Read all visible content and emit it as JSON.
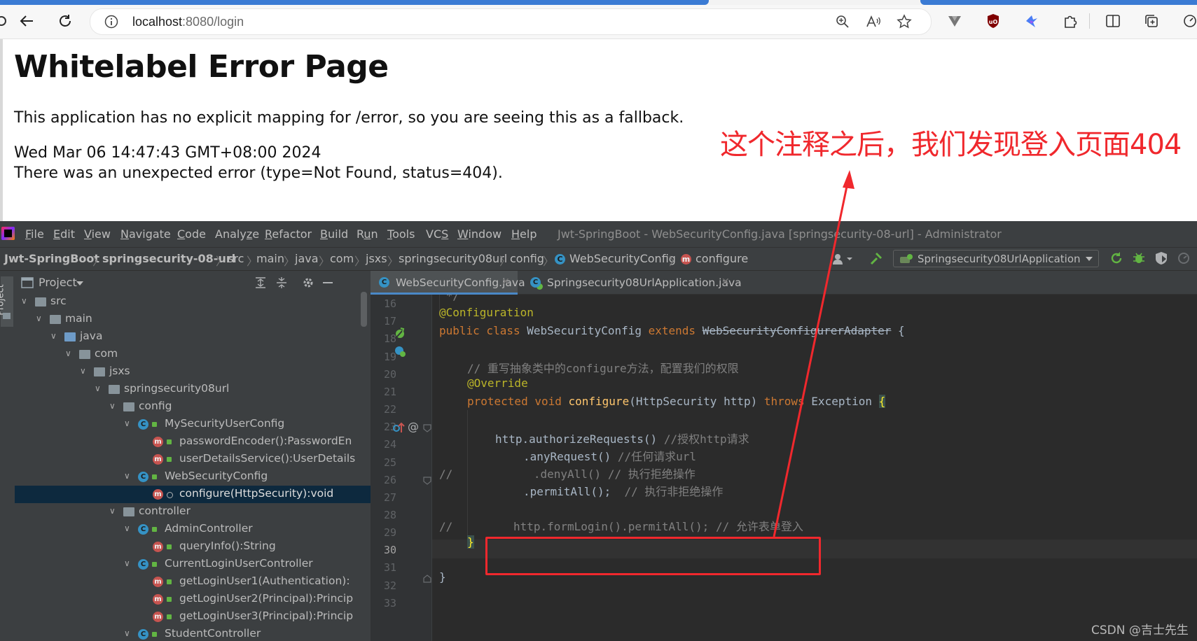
{
  "browser": {
    "url_host": "localhost",
    "url_rest": ":8080/login"
  },
  "page": {
    "title": "Whitelabel Error Page",
    "line1": "This application has no explicit mapping for /error, so you are seeing this as a fallback.",
    "line2": "Wed Mar 06 14:47:43 GMT+08:00 2024",
    "line3": "There was an unexpected error (type=Not Found, status=404)."
  },
  "annotation": {
    "text": "这个注释之后，我们发现登入页面404",
    "color": "#f0282d"
  },
  "ide": {
    "menu": [
      {
        "pre": "",
        "u": "F",
        "post": "ile"
      },
      {
        "pre": "",
        "u": "E",
        "post": "dit"
      },
      {
        "pre": "",
        "u": "V",
        "post": "iew"
      },
      {
        "pre": "",
        "u": "N",
        "post": "avigate"
      },
      {
        "pre": "",
        "u": "C",
        "post": "ode"
      },
      {
        "pre": "Analy",
        "u": "z",
        "post": "e"
      },
      {
        "pre": "",
        "u": "R",
        "post": "efactor"
      },
      {
        "pre": "",
        "u": "B",
        "post": "uild"
      },
      {
        "pre": "R",
        "u": "u",
        "post": "n"
      },
      {
        "pre": "",
        "u": "T",
        "post": "ools"
      },
      {
        "pre": "VC",
        "u": "S",
        "post": ""
      },
      {
        "pre": "",
        "u": "W",
        "post": "indow"
      },
      {
        "pre": "",
        "u": "H",
        "post": "elp"
      }
    ],
    "window_title": "Jwt-SpringBoot - WebSecurityConfig.java [springsecurity-08-url] - Administrator",
    "breadcrumbs": [
      "Jwt-SpringBoot",
      "springsecurity-08-url",
      "src",
      "main",
      "java",
      "com",
      "jsxs",
      "springsecurity08url",
      "config",
      "WebSecurityConfig",
      "configure"
    ],
    "run_config": "Springsecurity08UrlApplication",
    "project_panel": {
      "title": "Project",
      "side_label": "Project",
      "tree": [
        {
          "label": "src",
          "type": "folder"
        },
        {
          "label": "main",
          "type": "folder"
        },
        {
          "label": "java",
          "type": "folder-blue"
        },
        {
          "label": "com",
          "type": "package"
        },
        {
          "label": "jsxs",
          "type": "package"
        },
        {
          "label": "springsecurity08url",
          "type": "package"
        },
        {
          "label": "config",
          "type": "package"
        },
        {
          "label": "MySecurityUserConfig",
          "type": "class"
        },
        {
          "label": "passwordEncoder():PasswordEn",
          "type": "method"
        },
        {
          "label": "userDetailsService():UserDetails",
          "type": "method"
        },
        {
          "label": "WebSecurityConfig",
          "type": "class"
        },
        {
          "label": "configure(HttpSecurity):void",
          "type": "method",
          "selected": true
        },
        {
          "label": "controller",
          "type": "package"
        },
        {
          "label": "AdminController",
          "type": "class"
        },
        {
          "label": "queryInfo():String",
          "type": "method"
        },
        {
          "label": "CurrentLoginUserController",
          "type": "class"
        },
        {
          "label": "getLoginUser1(Authentication):",
          "type": "method"
        },
        {
          "label": "getLoginUser2(Principal):Princip",
          "type": "method"
        },
        {
          "label": "getLoginUser3(Principal):Princip",
          "type": "method"
        },
        {
          "label": "StudentController",
          "type": "class"
        }
      ]
    },
    "editor_tabs": [
      {
        "label": "WebSecurityConfig.java",
        "active": true
      },
      {
        "label": "Springsecurity08UrlApplication.java",
        "active": false
      }
    ],
    "line_numbers": [
      "16",
      "17",
      "18",
      "19",
      "20",
      "21",
      "22",
      "23",
      "24",
      "25",
      "26",
      "27",
      "28",
      "29",
      "30",
      "31",
      "32",
      "33"
    ],
    "current_line": "30",
    "code": {
      "l17": "@Configuration",
      "l18_kw": "public class ",
      "l18_name": "WebSecurityConfig ",
      "l18_ext": "extends ",
      "l18_super": "WebSecurityConfigurerAdapter",
      "l18_end": " {",
      "l20": "// 重写抽象类中的configure方法，配置我们的权限",
      "l21": "@Override",
      "l22_kw": "protected void ",
      "l22_fn": "configure",
      "l22_args": "(HttpSecurity http) ",
      "l22_throws": "throws ",
      "l22_exc": "Exception ",
      "l22_brace": "{",
      "l24_code": "http.authorizeRequests() ",
      "l24_cm": "//授权http请求",
      "l25_code": ".anyRequest() ",
      "l25_cm": "//任何请求url",
      "l26_cmt": "//            .denyAll() // 执行拒绝操作",
      "l27_code": ".permitAll();  ",
      "l27_cm": "// 执行非拒绝操作",
      "l29_cmt": "//         http.formLogin().permitAll(); // 允许表单登入",
      "l30": "}",
      "l32": "}"
    }
  },
  "watermark": "CSDN @吉士先生"
}
